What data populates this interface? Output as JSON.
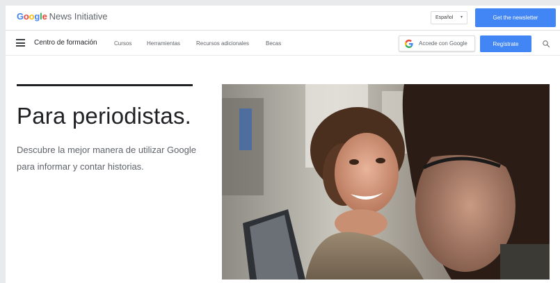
{
  "header": {
    "logo_google": "Google",
    "logo_rest": "News Initiative",
    "language": "Español",
    "newsletter_label": "Get the newsletter"
  },
  "nav": {
    "title": "Centro de formación",
    "links": [
      "Cursos",
      "Herramientas",
      "Recursos adicionales",
      "Becas"
    ],
    "signin_label": "Accede con Google",
    "register_label": "Regístrate"
  },
  "hero": {
    "title": "Para periodistas.",
    "subtitle": "Descubre la mejor manera de utilizar Google para informar y contar historias."
  },
  "colors": {
    "accent": "#4285f4",
    "text": "#202124",
    "muted": "#5f6368"
  },
  "icons": [
    "menu-icon",
    "google-g-icon",
    "search-icon",
    "chevron-down-icon"
  ]
}
